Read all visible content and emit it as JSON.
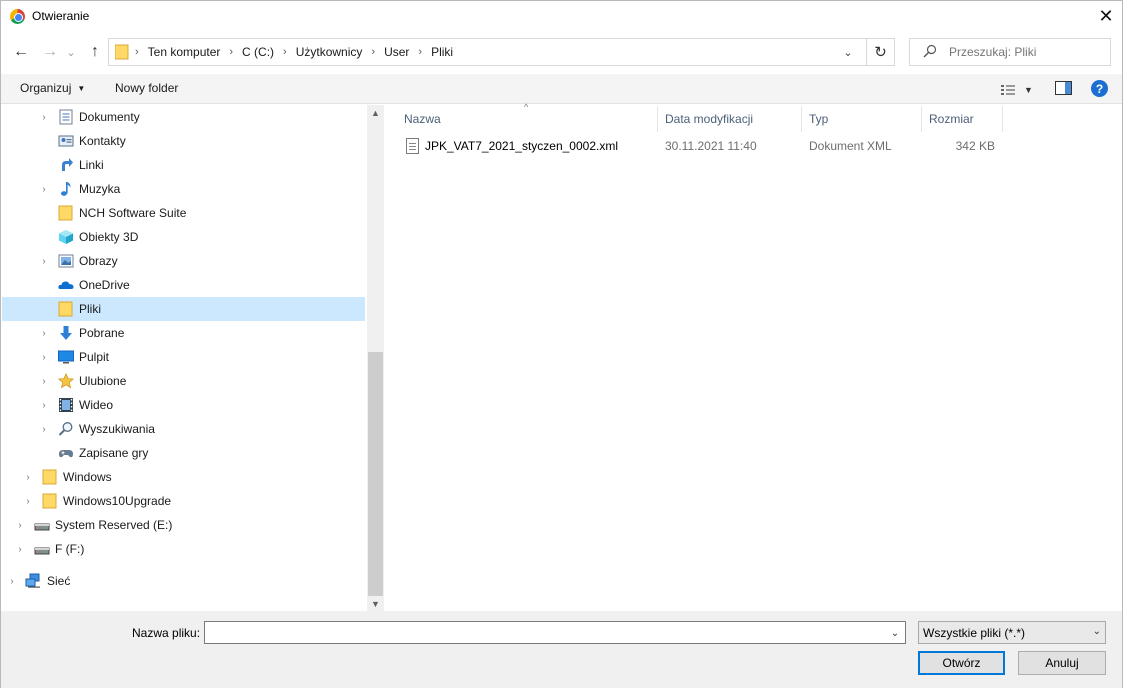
{
  "window": {
    "title": "Otwieranie",
    "close_glyph": "✕"
  },
  "nav": {
    "back_glyph": "←",
    "forward_glyph": "→",
    "recent_glyph": "⌄",
    "up_glyph": "↑"
  },
  "address": {
    "breadcrumbs": [
      "Ten komputer",
      "C (C:)",
      "Użytkownicy",
      "User",
      "Pliki"
    ],
    "dropdown_glyph": "⌄",
    "refresh_glyph": "↻"
  },
  "search": {
    "placeholder": "Przeszukaj: Pliki",
    "icon": "search-icon"
  },
  "toolbar": {
    "organize_label": "Organizuj",
    "new_folder_label": "Nowy folder",
    "help_glyph": "?"
  },
  "tree": [
    {
      "label": "Dokumenty",
      "icon": "documents-icon",
      "expandable": true
    },
    {
      "label": "Kontakty",
      "icon": "contacts-icon",
      "expandable": false
    },
    {
      "label": "Linki",
      "icon": "links-icon",
      "expandable": false
    },
    {
      "label": "Muzyka",
      "icon": "music-icon",
      "expandable": true
    },
    {
      "label": "NCH Software Suite",
      "icon": "folder-icon",
      "expandable": false
    },
    {
      "label": "Obiekty 3D",
      "icon": "objects-3d-icon",
      "expandable": false
    },
    {
      "label": "Obrazy",
      "icon": "pictures-icon",
      "expandable": true
    },
    {
      "label": "OneDrive",
      "icon": "onedrive-icon",
      "expandable": false
    },
    {
      "label": "Pliki",
      "icon": "folder-icon",
      "expandable": false,
      "selected": true
    },
    {
      "label": "Pobrane",
      "icon": "downloads-icon",
      "expandable": true
    },
    {
      "label": "Pulpit",
      "icon": "desktop-icon",
      "expandable": true
    },
    {
      "label": "Ulubione",
      "icon": "favorites-icon",
      "expandable": true
    },
    {
      "label": "Wideo",
      "icon": "video-icon",
      "expandable": true
    },
    {
      "label": "Wyszukiwania",
      "icon": "searches-icon",
      "expandable": true
    },
    {
      "label": "Zapisane gry",
      "icon": "saved-games-icon",
      "expandable": false
    },
    {
      "label": "Windows",
      "icon": "folder-icon",
      "expandable": true
    },
    {
      "label": "Windows10Upgrade",
      "icon": "folder-icon",
      "expandable": true
    },
    {
      "label": "System Reserved (E:)",
      "icon": "drive-icon",
      "expandable": true
    },
    {
      "label": "F (F:)",
      "icon": "drive-icon",
      "expandable": true
    },
    {
      "label": "Sieć",
      "icon": "network-icon",
      "expandable": true
    }
  ],
  "columns": {
    "name": "Nazwa",
    "modified": "Data modyfikacji",
    "type": "Typ",
    "size": "Rozmiar"
  },
  "files": [
    {
      "name": "JPK_VAT7_2021_styczen_0002.xml",
      "modified": "30.11.2021 11:40",
      "type": "Dokument XML",
      "size": "342 KB",
      "icon": "xml-file-icon"
    }
  ],
  "footer": {
    "filename_label": "Nazwa pliku:",
    "filename_value": "",
    "filter_value": "Wszystkie pliki (*.*)",
    "open_label": "Otwórz",
    "cancel_label": "Anuluj"
  },
  "colors": {
    "selection": "#cce8ff",
    "accent": "#0078d7",
    "header_text": "#4c607a"
  }
}
